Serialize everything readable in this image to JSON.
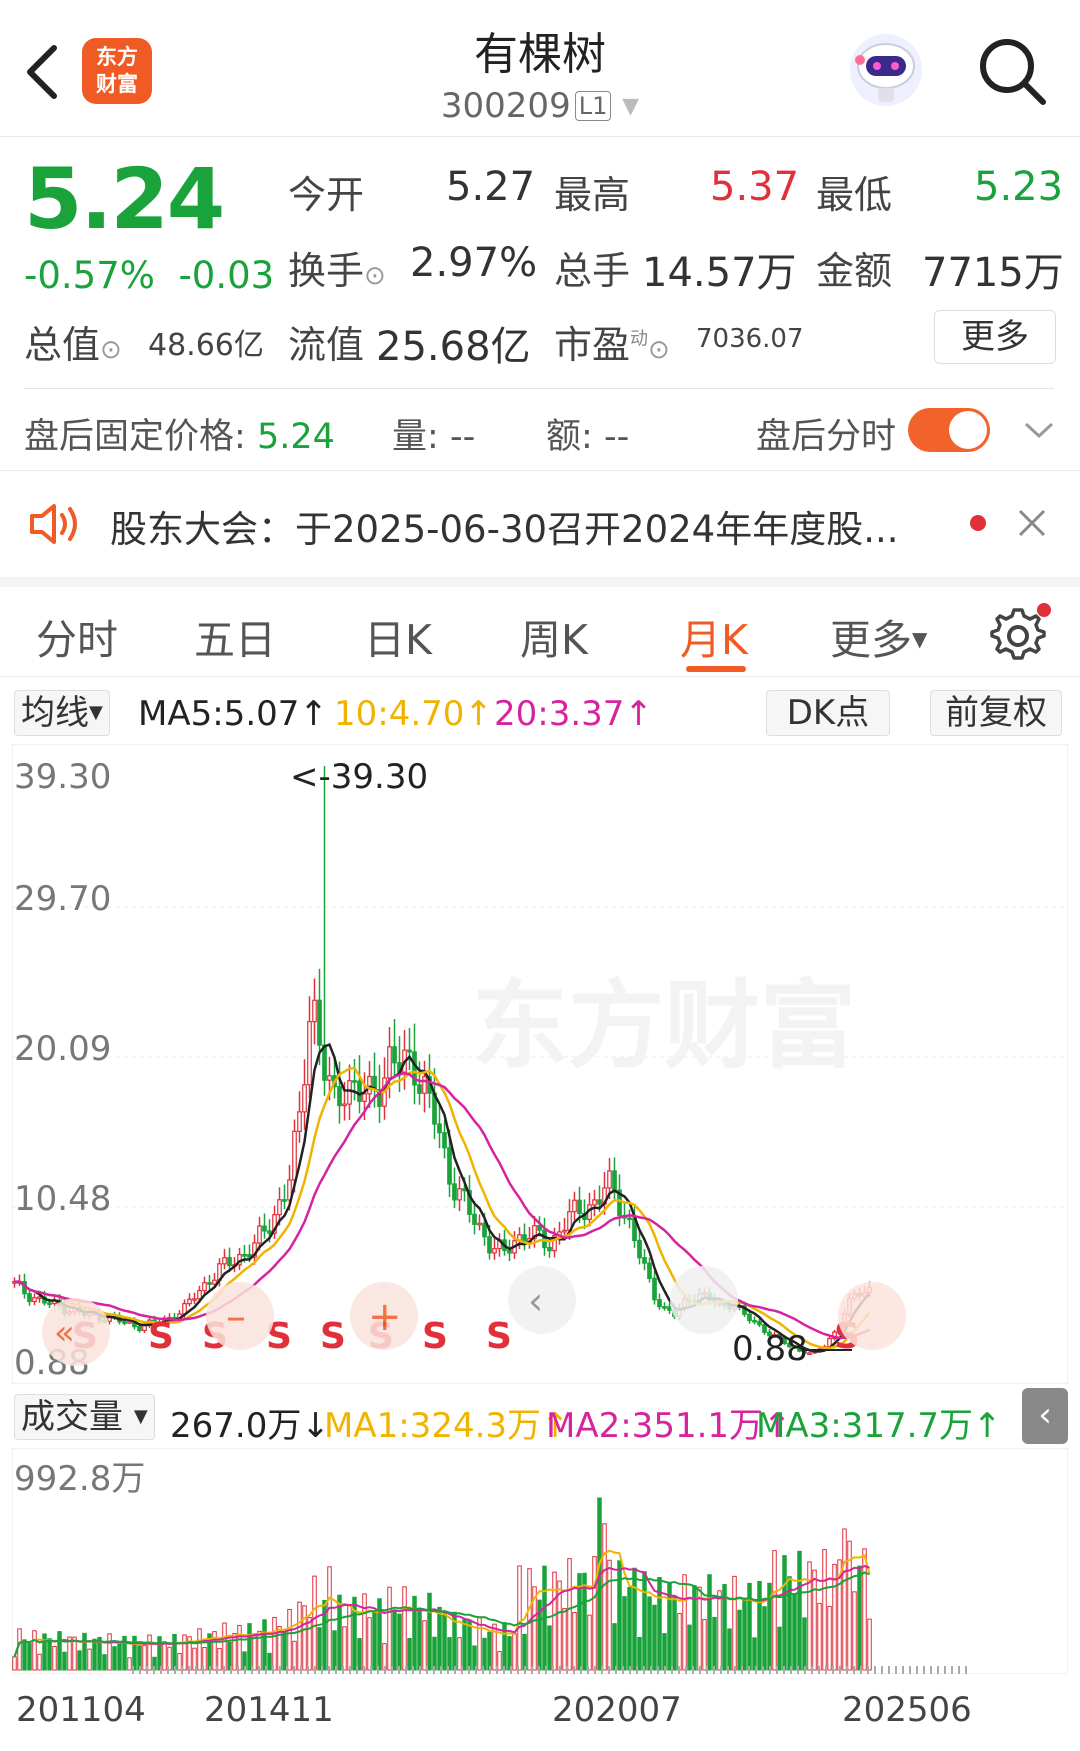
{
  "header": {
    "logo_text_1": "东方",
    "logo_text_2": "财富",
    "title": "有棵树",
    "code": "300209",
    "code_badge": "L1"
  },
  "quote": {
    "price": "5.24",
    "change_pct": "-0.57%",
    "change": "-0.03",
    "open_label": "今开",
    "open": "5.27",
    "high_label": "最高",
    "high": "5.37",
    "low_label": "最低",
    "low": "5.23",
    "turnover_label": "换手",
    "turnover": "2.97%",
    "volume_label": "总手",
    "volume": "14.57万",
    "amount_label": "金额",
    "amount": "7715万",
    "mktcap_label": "总值",
    "mktcap": "48.66亿",
    "float_label": "流值",
    "float": "25.68亿",
    "pe_label": "市盈",
    "pe_sup": "动",
    "pe": "7036.07",
    "more_button": "更多"
  },
  "after_hours": {
    "price_label": "盘后固定价格:",
    "price": "5.24",
    "vol_label": "量:",
    "vol": "--",
    "amt_label": "额:",
    "amt": "--",
    "toggle_label": "盘后分时",
    "toggle_on": true
  },
  "notice": {
    "text": "股东大会：于2025-06-30召开2024年年度股..."
  },
  "tabs": [
    "分时",
    "五日",
    "日K",
    "周K",
    "月K",
    "更多"
  ],
  "active_tab": "月K",
  "ma_bar": {
    "selector": "均线",
    "ma5": "MA5:5.07",
    "ma10": "10:4.70",
    "ma20": "20:3.37",
    "dk_button": "DK点",
    "fq_button": "前复权"
  },
  "price_axis": {
    "labels": [
      "39.30",
      "29.70",
      "20.09",
      "10.48",
      "0.88"
    ],
    "max_marker": "<-39.30",
    "min_marker": "0.88"
  },
  "signal_markers": [
    "S",
    "S",
    "S",
    "S",
    "S",
    "S",
    "S",
    "S",
    "S"
  ],
  "volume_bar": {
    "selector": "成交量",
    "vol": "267.0万",
    "ma1": "MA1:324.3万",
    "ma2": "MA2:351.1万",
    "ma3": "MA3:317.7万"
  },
  "volume_axis": {
    "max": "992.8万"
  },
  "x_axis": [
    "201104",
    "201411",
    "202007",
    "202506"
  ],
  "watermark": "东方财富",
  "colors": {
    "up": "#e0313b",
    "down": "#1aa33a",
    "accent": "#f05a24",
    "ma5": "#222222",
    "ma10": "#f0b400",
    "ma20": "#d6249f"
  },
  "chart_data": {
    "type": "candlestick",
    "period": "monthly",
    "ylim": [
      0.88,
      39.3
    ],
    "x_ticks": [
      "201104",
      "201411",
      "202007",
      "202506"
    ],
    "y_ticks": [
      39.3,
      29.7,
      20.09,
      10.48,
      0.88
    ],
    "close_path": [
      5.5,
      5.0,
      4.6,
      4.3,
      4.1,
      3.9,
      3.6,
      3.5,
      3.4,
      3.2,
      3.0,
      2.8,
      3.0,
      3.2,
      3.5,
      4.0,
      5.0,
      5.8,
      6.5,
      7.0,
      7.5,
      8.0,
      9.0,
      10.5,
      12.0,
      16.0,
      25.0,
      20.0,
      17.0,
      19.0,
      18.0,
      17.5,
      19.0,
      20.0,
      19.5,
      20.5,
      18.0,
      16.0,
      13.0,
      11.5,
      10.0,
      9.0,
      8.0,
      7.5,
      8.5,
      9.0,
      8.5,
      8.0,
      9.5,
      10.0,
      10.5,
      11.0,
      12.0,
      11.0,
      9.5,
      7.0,
      5.0,
      4.0,
      3.5,
      4.5,
      5.0,
      4.5,
      4.0,
      4.5,
      3.5,
      3.0,
      2.5,
      2.0,
      1.5,
      1.2,
      1.0,
      1.5,
      2.5,
      4.0,
      5.0,
      5.24
    ],
    "series": [
      {
        "name": "MA5",
        "value_last": 5.07
      },
      {
        "name": "MA10",
        "value_last": 4.7
      },
      {
        "name": "MA20",
        "value_last": 3.37
      }
    ],
    "volume": {
      "ymax": "992.8万",
      "last": "267.0万",
      "ma": {
        "MA1": "324.3万",
        "MA2": "351.1万",
        "MA3": "317.7万"
      }
    }
  }
}
